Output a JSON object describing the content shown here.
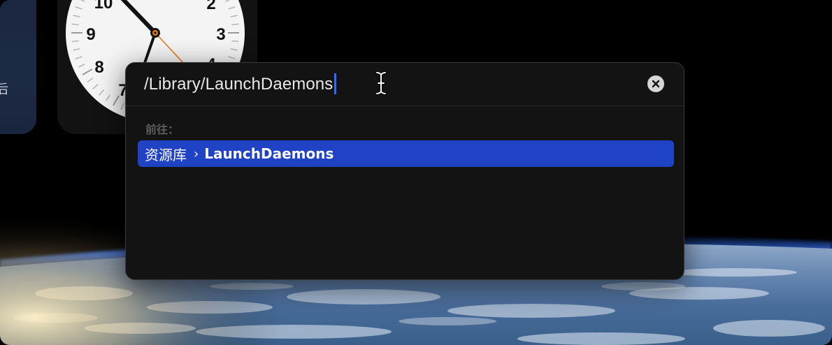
{
  "left_widget": {
    "partial_text": "后"
  },
  "clock": {
    "visible_numerals": [
      "10",
      "2",
      "9",
      "3",
      "8",
      "7",
      "4"
    ],
    "hour_hand_direction": "toward 10",
    "accent_color": "#e07b1a"
  },
  "goto_panel": {
    "path_value": "/Library/LaunchDaemons",
    "caret_color": "#2f6bff",
    "clear_icon": "x-circle-icon",
    "section_label": "前往：",
    "results": [
      {
        "parent": "资源库",
        "separator": "›",
        "name": "LaunchDaemons",
        "highlight_color": "#1f43c4"
      }
    ]
  },
  "cursor": {
    "icon": "ibeam-cursor-icon"
  }
}
